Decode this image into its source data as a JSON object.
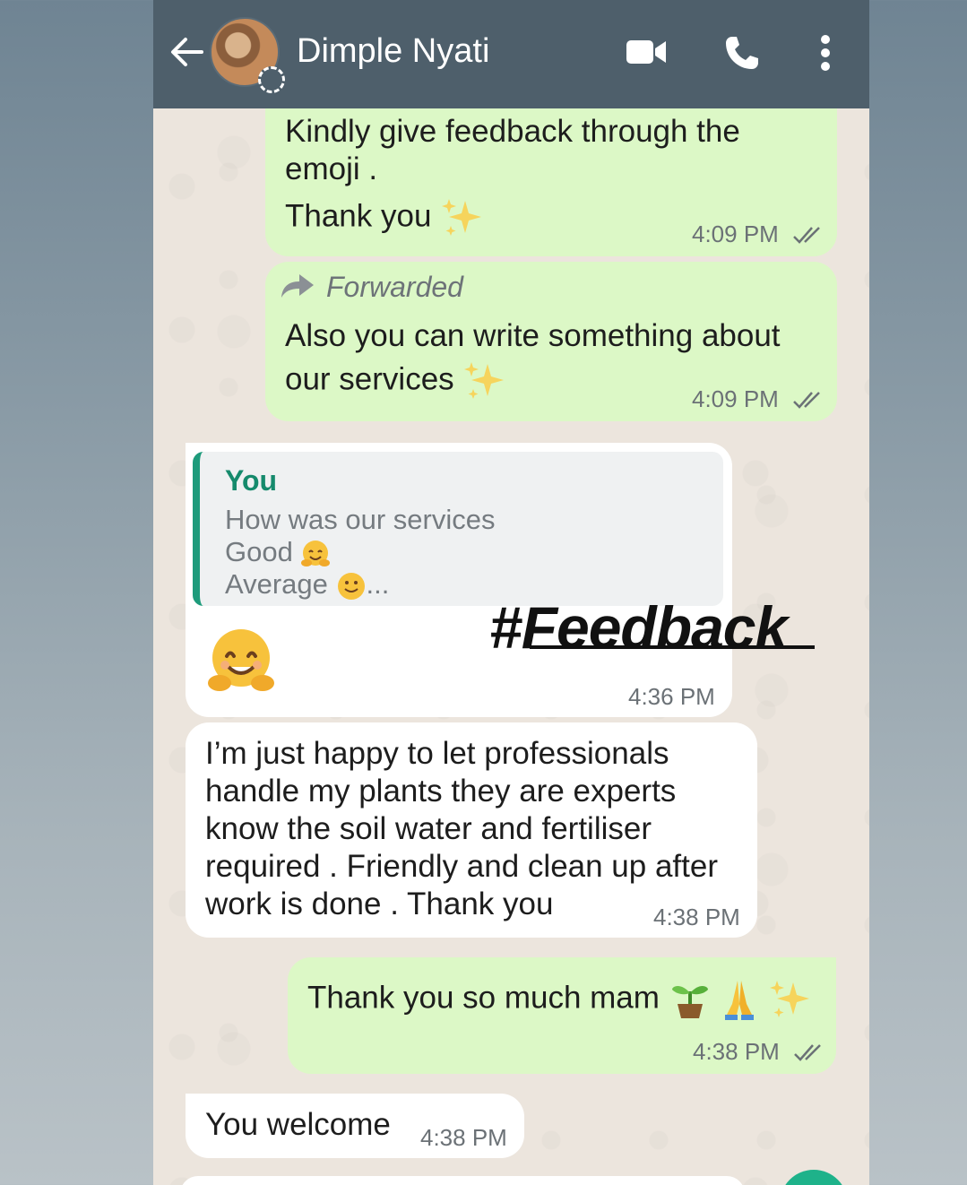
{
  "header": {
    "contact_name": "Dimple Nyati",
    "icons": [
      "back-arrow-icon",
      "avatar",
      "status-icon",
      "video-call-icon",
      "phone-icon",
      "more-options-icon"
    ],
    "bg_color": "#4e5f6b"
  },
  "messages": [
    {
      "direction": "outgoing",
      "lines": [
        "Kindly give feedback through the",
        "emoji .",
        "Thank you"
      ],
      "emoji": "sparkles",
      "time": "4:09 PM",
      "read": true
    },
    {
      "direction": "outgoing",
      "forwarded_label": "Forwarded",
      "lines": [
        "Also you can write something about",
        "our services"
      ],
      "emoji": "sparkles",
      "time": "4:09 PM",
      "read": true
    },
    {
      "direction": "incoming",
      "quote": {
        "author": "You",
        "line1": "How was our services",
        "line2": "Good",
        "line3": "Average",
        "ellipsis": "..."
      },
      "emoji": "hugging-face",
      "time": "4:36 PM"
    },
    {
      "direction": "incoming",
      "lines": [
        "I’m just happy to let professionals",
        "handle my plants they are experts",
        "know the soil water and fertiliser",
        "required . Friendly and clean up after",
        "work is done . Thank you"
      ],
      "time": "4:38 PM"
    },
    {
      "direction": "outgoing",
      "text": "Thank you so much mam",
      "emojis": [
        "seedling",
        "folded-hands",
        "sparkles"
      ],
      "time": "4:38 PM",
      "read": true
    },
    {
      "direction": "incoming",
      "text": "You welcome",
      "time": "4:38 PM"
    }
  ],
  "overlay": {
    "hashtag": "#Feedback"
  },
  "colors": {
    "outgoing_bubble": "#dcf8c6",
    "incoming_bubble": "#ffffff",
    "chat_bg": "#ece5dd",
    "quote_accent": "#1e9b7b",
    "read_ticks": "#6b7176"
  }
}
